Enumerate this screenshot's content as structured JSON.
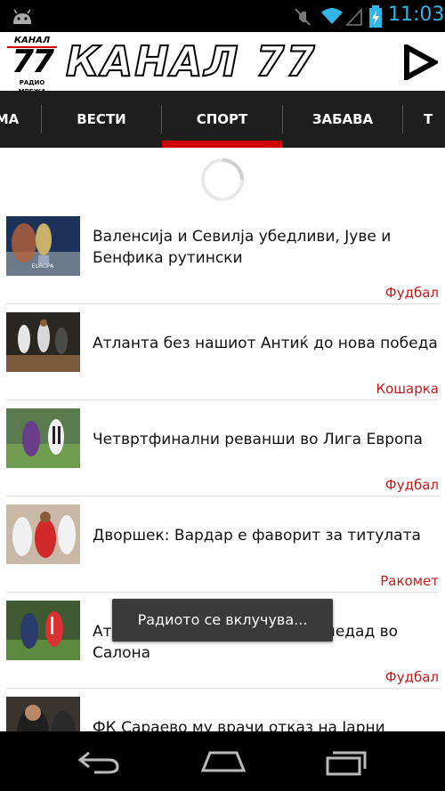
{
  "status_bar": {
    "time": "11:03",
    "icons": [
      "android-icon",
      "mute-icon",
      "wifi-icon",
      "signal-icon",
      "battery-charging-icon"
    ]
  },
  "header": {
    "logo": {
      "top_text": "КАНАЛ",
      "number": "77",
      "sub_text": "РАДИО МРЕЖА"
    },
    "title": "КАНАЛ 77",
    "play_icon": "play-icon"
  },
  "tabs": [
    {
      "label": "МА"
    },
    {
      "label": "ВЕСТИ"
    },
    {
      "label": "СПОРТ",
      "selected": true
    },
    {
      "label": "ЗАБАВА"
    },
    {
      "label": "Т"
    }
  ],
  "articles": [
    {
      "title": "Валенсија и Севилја убедливи, Јуве и Бенфика рутински",
      "category": "Фудбал"
    },
    {
      "title": "Атланта без нашиот Антиќ до нова победа",
      "category": "Кошарка"
    },
    {
      "title": "Четвртфинални реванши во Лига Европа",
      "category": "Фудбал"
    },
    {
      "title": "Дворшек: Вардар е фаворит за титулата",
      "category": "Ракомет"
    },
    {
      "title": "Атлетико ја разбија Реал Сосиедад во Салона",
      "category": "Фудбал"
    },
    {
      "title": "ФК Сараево му врачи отказ на Јарни",
      "category": ""
    }
  ],
  "toast": {
    "text": "Радиото се вклучува..."
  },
  "colors": {
    "accent": "#cc0000",
    "tab_bar": "#1e1e1e",
    "category": "#c41a1a",
    "status_accent": "#33b5e5"
  }
}
